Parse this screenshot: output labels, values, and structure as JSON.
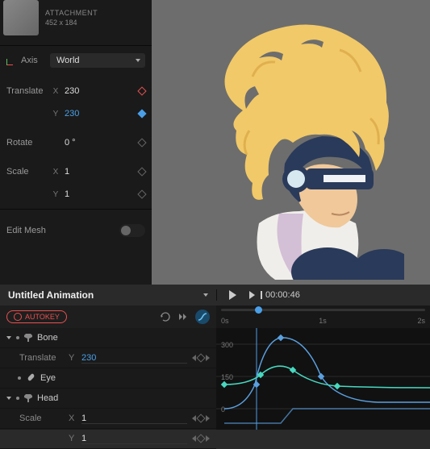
{
  "attachment": {
    "label": "ATTACHMENT",
    "dimensions": "452 x 184"
  },
  "properties": {
    "axis": {
      "label": "Axis",
      "value": "World"
    },
    "translate": {
      "label": "Translate",
      "x_label": "X",
      "x_value": "230",
      "y_label": "Y",
      "y_value": "230"
    },
    "rotate": {
      "label": "Rotate",
      "value": "0 °"
    },
    "scale": {
      "label": "Scale",
      "x_label": "X",
      "x_value": "1",
      "y_label": "Y",
      "y_value": "1"
    },
    "edit_mesh": {
      "label": "Edit Mesh"
    }
  },
  "animation": {
    "title": "Untitled Animation"
  },
  "toolbar": {
    "autokey_label": "AUTOKEY"
  },
  "playback": {
    "time": "00:00:46"
  },
  "ruler": {
    "ticks": [
      "0s",
      "1s",
      "2s"
    ],
    "scrub_position": 0.18
  },
  "tracks": {
    "bone": {
      "label": "Bone",
      "translate_label": "Translate",
      "translate_axis": "Y",
      "translate_value": "230"
    },
    "eye": {
      "label": "Eye"
    },
    "head": {
      "label": "Head",
      "scale_label": "Scale",
      "scale_x_axis": "X",
      "scale_x_value": "1",
      "scale_y_axis": "Y",
      "scale_y_value": "1"
    }
  },
  "graph": {
    "y_ticks": [
      "300",
      "150",
      "0"
    ],
    "colors": {
      "curve_a": "#5aa0e0",
      "curve_b": "#48d8c0"
    }
  }
}
